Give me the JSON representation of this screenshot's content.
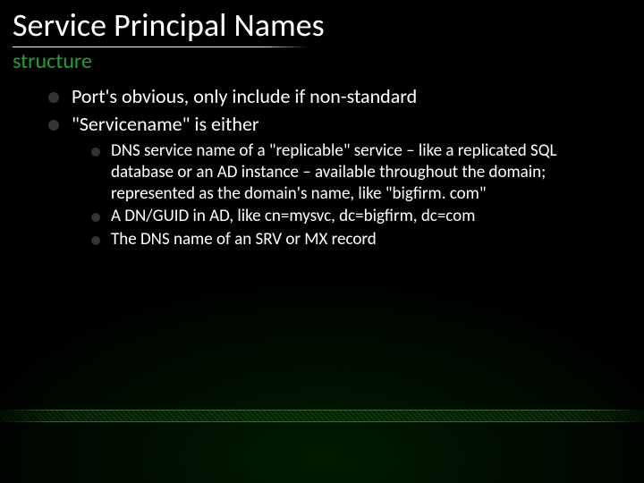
{
  "title": "Service Principal Names",
  "subtitle": "structure",
  "bullets": [
    {
      "text": "Port's obvious, only include if non-standard"
    },
    {
      "text": "\"Servicename\" is either",
      "children": [
        {
          "text": "DNS service name of a \"replicable\" service – like a replicated SQL database or an AD instance – available throughout the domain; represented as the domain's name, like \"bigfirm. com\""
        },
        {
          "text": "A DN/GUID in AD, like cn=mysvc, dc=bigfirm, dc=com"
        },
        {
          "text": "The DNS name of an SRV or MX record"
        }
      ]
    }
  ]
}
